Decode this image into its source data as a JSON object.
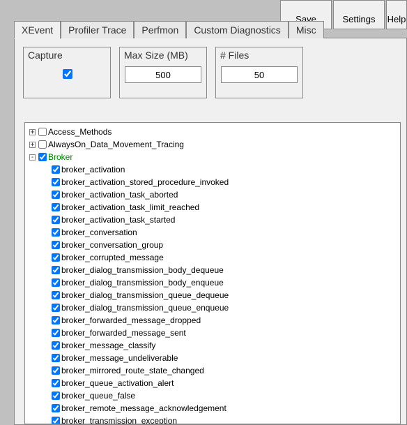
{
  "toolbar": {
    "save": "Save",
    "settings": "Settings",
    "help": "Help"
  },
  "tabs": [
    {
      "label": "XEvent",
      "active": true
    },
    {
      "label": "Profiler Trace",
      "active": false
    },
    {
      "label": "Perfmon",
      "active": false
    },
    {
      "label": "Custom Diagnostics",
      "active": false
    },
    {
      "label": "Misc",
      "active": false
    }
  ],
  "config": {
    "capture": {
      "label": "Capture",
      "checked": true
    },
    "max_size": {
      "label": "Max Size (MB)",
      "value": "500"
    },
    "files": {
      "label": "# Files",
      "value": "50"
    }
  },
  "tree": [
    {
      "level": 1,
      "expander": "+",
      "checked": false,
      "label": "Access_Methods",
      "green": false
    },
    {
      "level": 1,
      "expander": "+",
      "checked": false,
      "label": "AlwaysOn_Data_Movement_Tracing",
      "green": false
    },
    {
      "level": 1,
      "expander": "-",
      "checked": true,
      "label": "Broker",
      "green": true
    },
    {
      "level": 2,
      "expander": null,
      "checked": true,
      "label": "broker_activation",
      "green": false
    },
    {
      "level": 2,
      "expander": null,
      "checked": true,
      "label": "broker_activation_stored_procedure_invoked",
      "green": false
    },
    {
      "level": 2,
      "expander": null,
      "checked": true,
      "label": "broker_activation_task_aborted",
      "green": false
    },
    {
      "level": 2,
      "expander": null,
      "checked": true,
      "label": "broker_activation_task_limit_reached",
      "green": false
    },
    {
      "level": 2,
      "expander": null,
      "checked": true,
      "label": "broker_activation_task_started",
      "green": false
    },
    {
      "level": 2,
      "expander": null,
      "checked": true,
      "label": "broker_conversation",
      "green": false
    },
    {
      "level": 2,
      "expander": null,
      "checked": true,
      "label": "broker_conversation_group",
      "green": false
    },
    {
      "level": 2,
      "expander": null,
      "checked": true,
      "label": "broker_corrupted_message",
      "green": false
    },
    {
      "level": 2,
      "expander": null,
      "checked": true,
      "label": "broker_dialog_transmission_body_dequeue",
      "green": false
    },
    {
      "level": 2,
      "expander": null,
      "checked": true,
      "label": "broker_dialog_transmission_body_enqueue",
      "green": false
    },
    {
      "level": 2,
      "expander": null,
      "checked": true,
      "label": "broker_dialog_transmission_queue_dequeue",
      "green": false
    },
    {
      "level": 2,
      "expander": null,
      "checked": true,
      "label": "broker_dialog_transmission_queue_enqueue",
      "green": false
    },
    {
      "level": 2,
      "expander": null,
      "checked": true,
      "label": "broker_forwarded_message_dropped",
      "green": false
    },
    {
      "level": 2,
      "expander": null,
      "checked": true,
      "label": "broker_forwarded_message_sent",
      "green": false
    },
    {
      "level": 2,
      "expander": null,
      "checked": true,
      "label": "broker_message_classify",
      "green": false
    },
    {
      "level": 2,
      "expander": null,
      "checked": true,
      "label": "broker_message_undeliverable",
      "green": false
    },
    {
      "level": 2,
      "expander": null,
      "checked": true,
      "label": "broker_mirrored_route_state_changed",
      "green": false
    },
    {
      "level": 2,
      "expander": null,
      "checked": true,
      "label": "broker_queue_activation_alert",
      "green": false
    },
    {
      "level": 2,
      "expander": null,
      "checked": true,
      "label": "broker_queue_false",
      "green": false
    },
    {
      "level": 2,
      "expander": null,
      "checked": true,
      "label": "broker_remote_message_acknowledgement",
      "green": false
    },
    {
      "level": 2,
      "expander": null,
      "checked": true,
      "label": "broker_transmission_exception",
      "green": false
    }
  ]
}
